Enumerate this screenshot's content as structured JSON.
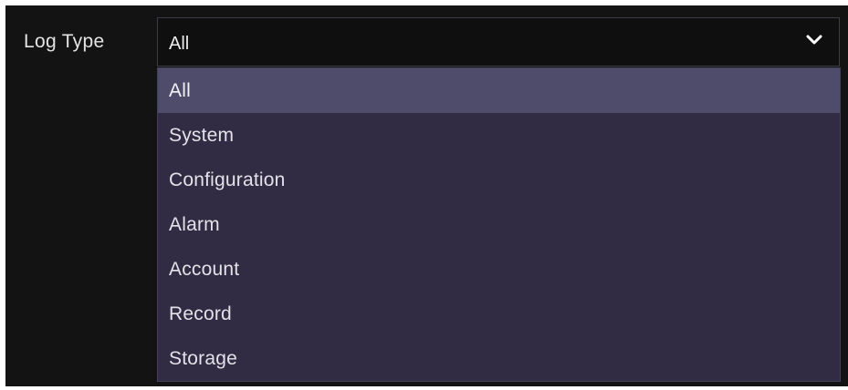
{
  "log_type": {
    "label": "Log Type",
    "selected_value": "All",
    "chevron_icon": "chevron-down-icon",
    "options": [
      "All",
      "System",
      "Configuration",
      "Alarm",
      "Account",
      "Record",
      "Storage"
    ],
    "selected_index": 0
  },
  "colors": {
    "panel_background": "#131313",
    "dropdown_background": "#312c43",
    "selected_item_background": "#4e4c6a",
    "text": "#e2e2e8"
  }
}
